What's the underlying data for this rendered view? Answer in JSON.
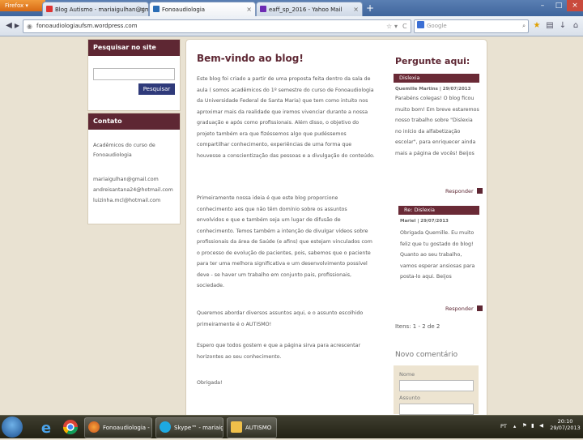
{
  "browser": {
    "menu_button": "Firefox",
    "tabs": [
      {
        "label": "Blog Autismo - mariaigulhan@gmai..."
      },
      {
        "label": "Fonoaudiologia"
      },
      {
        "label": "eaff_sp_2016 - Yahoo Mail"
      }
    ],
    "new_tab": "+",
    "url": "fonoaudiologiaufsm.wordpress.com",
    "search_placeholder": "Google",
    "colors": {
      "tabbar": "#3f659c",
      "menu_button": "#d86a14"
    }
  },
  "left": {
    "search_title": "Pesquisar no site",
    "search_button": "Pesquisar",
    "contact_title": "Contato",
    "contact_lines": [
      "Acadêmicos do curso de",
      "Fonoaudiologia"
    ],
    "emails": [
      "mariaigulhan@gmail.com",
      "andreisantana24@hotmail.com",
      "luizinha.mcl@hotmail.com"
    ]
  },
  "post": {
    "title": "Bem-vindo ao blog!",
    "p1": "Este blog foi criado a partir de uma proposta feita dentro da sala de aula ( somos acadêmicos do 1º semestre do curso de Fonoaudiologia da Universidade Federal de Santa Maria) que tem como intuito nos aproximar mais da realidade que iremos vivenciar durante a nossa graduação e após como profissionais. Além disso, o objetivo do projeto também era que fizéssemos algo que pudéssemos compartilhar conhecimento, experiências de uma forma que houvesse a conscientização das pessoas e a divulgação do conteúdo.",
    "p2": "Primeiramente nossa ideia é que este blog proporcione conhecimento aos que não têm domínio sobre os assuntos envolvidos e que e também seja um lugar de difusão de conhecimento. Temos também a intenção de divulgar vídeos sobre profissionais da área de Saúde (e afins) que estejam vinculados com o processo de evolução de pacientes, pois, sabemos que o paciente para ter uma melhora significativa e um desenvolvimento possível deve - se haver um trabalho em conjunto pais, profissionais, sociedade.",
    "p3": "Queremos abordar diversos assuntos aqui, e o assunto escolhido primeiramente é o AUTISMO!",
    "p4": "Espero que todos gostem e que a página sirva para acrescentar horizontes ao seu conhecimento.",
    "p5": "Obrigada!"
  },
  "right": {
    "title": "Pergunte aqui:",
    "comment1_header": "Dislexia",
    "comment1_meta": "Quemille Martins | 29/07/2013",
    "comment1_text": "Parabéns colegas! O blog ficou muito bom! Em breve estaremos nosso trabalho sobre \"Dislexia no início da alfabetização escolar\", para enriquecer ainda mais a página de vocês! Beijos",
    "reply_label": "Responder",
    "comment2_header": "Re: Dislexia",
    "comment2_meta": "Mariel | 29/07/2013",
    "comment2_text": "Obrigada Quemille. Eu muito feliz que tu gostado do blog! Quanto ao seu trabalho, vamos esperar ansiosas para posta-lo aqui. Beijos",
    "pagination": "Itens: 1 - 2 de 2",
    "new_comment_title": "Novo comentário",
    "name_label": "Nome",
    "subject_label": "Assunto"
  },
  "taskbar": {
    "buttons": [
      {
        "label": "Fonoaudiologia - ..."
      },
      {
        "label": "Skype™ - mariaig..."
      },
      {
        "label": "AUTISMO"
      }
    ],
    "language": "PT",
    "time": "20:10",
    "date": "29/07/2013"
  }
}
